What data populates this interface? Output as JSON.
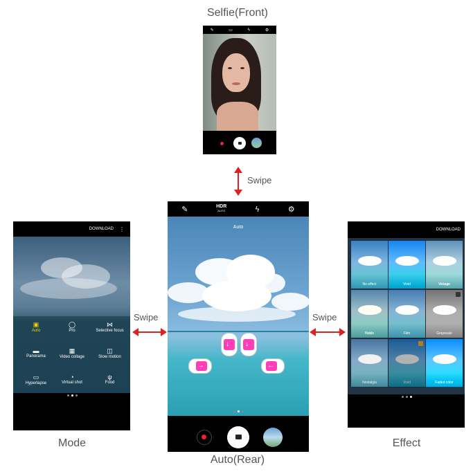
{
  "captions": {
    "top": "Selfie(Front)",
    "center": "Auto(Rear)",
    "left": "Mode",
    "right": "Effect"
  },
  "swipe": {
    "up": "Swipe",
    "left": "Swipe",
    "right": "Swipe"
  },
  "rear_screen": {
    "mode_label": "Auto",
    "hdr_label": "HDR",
    "hdr_sub": "AUTO"
  },
  "mode_screen": {
    "download": "DOWNLOAD",
    "items": [
      {
        "label": "Auto",
        "icon": "camera-icon"
      },
      {
        "label": "Pro",
        "icon": "aperture-icon"
      },
      {
        "label": "Selective focus",
        "icon": "focus-icon"
      },
      {
        "label": "Panorama",
        "icon": "panorama-icon"
      },
      {
        "label": "Video collage",
        "icon": "collage-icon"
      },
      {
        "label": "Slow motion",
        "icon": "slow-motion-icon"
      },
      {
        "label": "Hyperlapse",
        "icon": "hyperlapse-icon"
      },
      {
        "label": "Virtual shot",
        "icon": "virtual-shot-icon"
      },
      {
        "label": "Food",
        "icon": "food-icon"
      }
    ]
  },
  "effect_screen": {
    "download": "DOWNLOAD",
    "tiles": [
      "No effect",
      "Vivid",
      "Vintage",
      "Noble",
      "Film",
      "Grayscale",
      "Nostalgia",
      "Vivid",
      "Faded color"
    ]
  },
  "colors": {
    "arrow": "#e02020",
    "touch": "#ff3db7",
    "mode_selected": "#f0d000"
  }
}
